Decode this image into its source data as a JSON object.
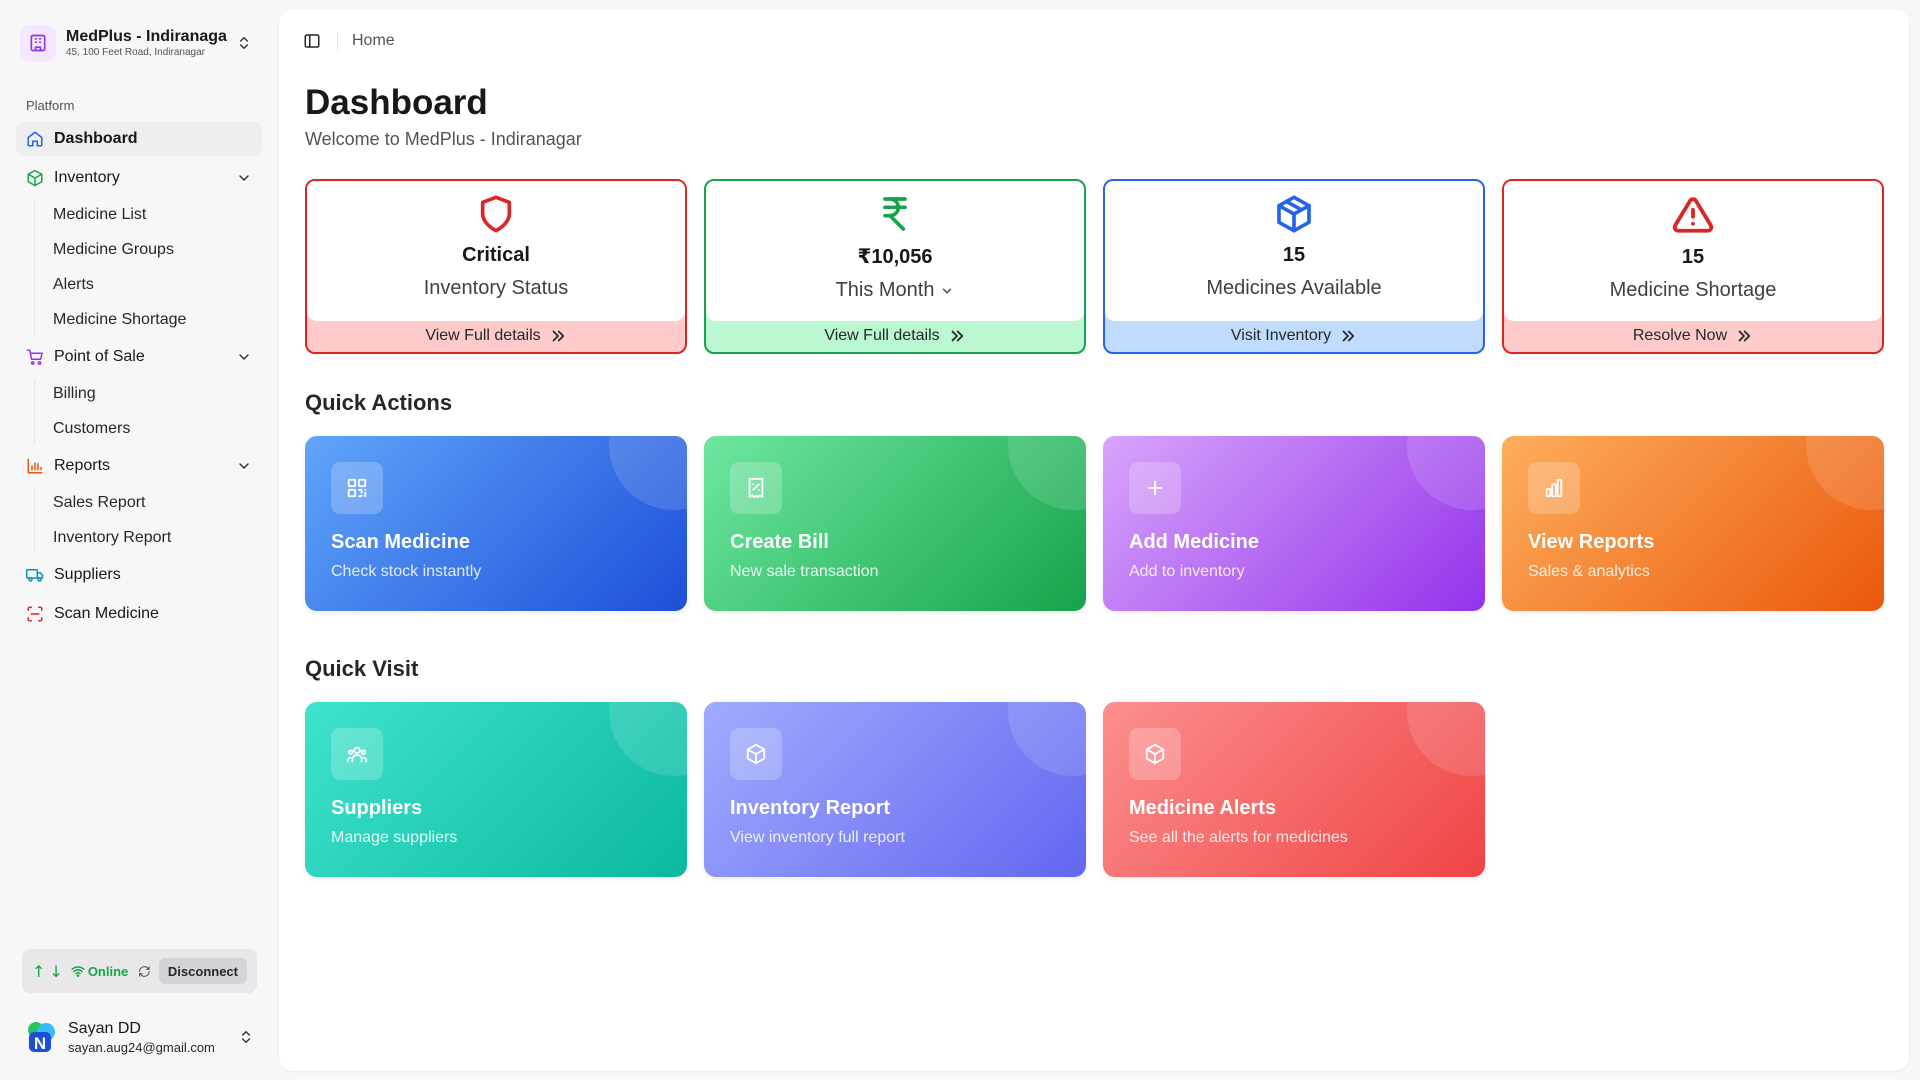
{
  "store": {
    "name": "MedPlus - Indiranaga",
    "address": "45, 100 Feet Road, Indiranagar"
  },
  "sidebar": {
    "group_label": "Platform",
    "items": [
      {
        "label": "Dashboard",
        "icon": "home-icon",
        "active": true
      },
      {
        "label": "Inventory",
        "icon": "inventory-icon",
        "children": [
          "Medicine List",
          "Medicine Groups",
          "Alerts",
          "Medicine Shortage"
        ]
      },
      {
        "label": "Point of Sale",
        "icon": "cart-icon",
        "children": [
          "Billing",
          "Customers"
        ]
      },
      {
        "label": "Reports",
        "icon": "bar-chart-icon",
        "children": [
          "Sales Report",
          "Inventory Report"
        ]
      },
      {
        "label": "Suppliers",
        "icon": "truck-icon"
      },
      {
        "label": "Scan Medicine",
        "icon": "scan-icon"
      }
    ]
  },
  "connection": {
    "up_arrow": "↑",
    "down_arrow": "↓",
    "status": "Online",
    "disconnect_label": "Disconnect"
  },
  "user": {
    "name": "Sayan DD",
    "email": "sayan.aug24@gmail.com"
  },
  "breadcrumb": "Home",
  "page": {
    "title": "Dashboard",
    "subtitle": "Welcome to MedPlus - Indiranagar"
  },
  "stats": [
    {
      "value": "Critical",
      "label": "Inventory Status",
      "link": "View Full details",
      "icon": "shield-icon",
      "color": "#dc2626",
      "footer_bg": "#fecaca"
    },
    {
      "value": "₹10,056",
      "label": "This Month",
      "link": "View Full details",
      "icon": "rupee-icon",
      "color": "#16a34a",
      "footer_bg": "#bbf7d0"
    },
    {
      "value": "15",
      "label": "Medicines Available",
      "link": "Visit Inventory",
      "icon": "box-icon",
      "color": "#2563eb",
      "footer_bg": "#bfdbfe"
    },
    {
      "value": "15",
      "label": "Medicine Shortage",
      "link": "Resolve Now",
      "icon": "warning-icon",
      "color": "#dc2626",
      "footer_bg": "#fecaca"
    }
  ],
  "quick_actions": {
    "title": "Quick Actions",
    "cards": [
      {
        "title": "Scan Medicine",
        "subtitle": "Check stock instantly",
        "icon": "qr-scan-icon"
      },
      {
        "title": "Create Bill",
        "subtitle": "New sale transaction",
        "icon": "receipt-icon"
      },
      {
        "title": "Add Medicine",
        "subtitle": "Add to inventory",
        "icon": "plus-icon"
      },
      {
        "title": "View Reports",
        "subtitle": "Sales & analytics",
        "icon": "bar-chart-icon"
      }
    ]
  },
  "quick_visit": {
    "title": "Quick Visit",
    "cards": [
      {
        "title": "Suppliers",
        "subtitle": "Manage suppliers",
        "icon": "users-icon"
      },
      {
        "title": "Inventory Report",
        "subtitle": "View inventory full report",
        "icon": "box-icon"
      },
      {
        "title": "Medicine Alerts",
        "subtitle": "See all the alerts for medicines",
        "icon": "box-icon"
      }
    ]
  }
}
